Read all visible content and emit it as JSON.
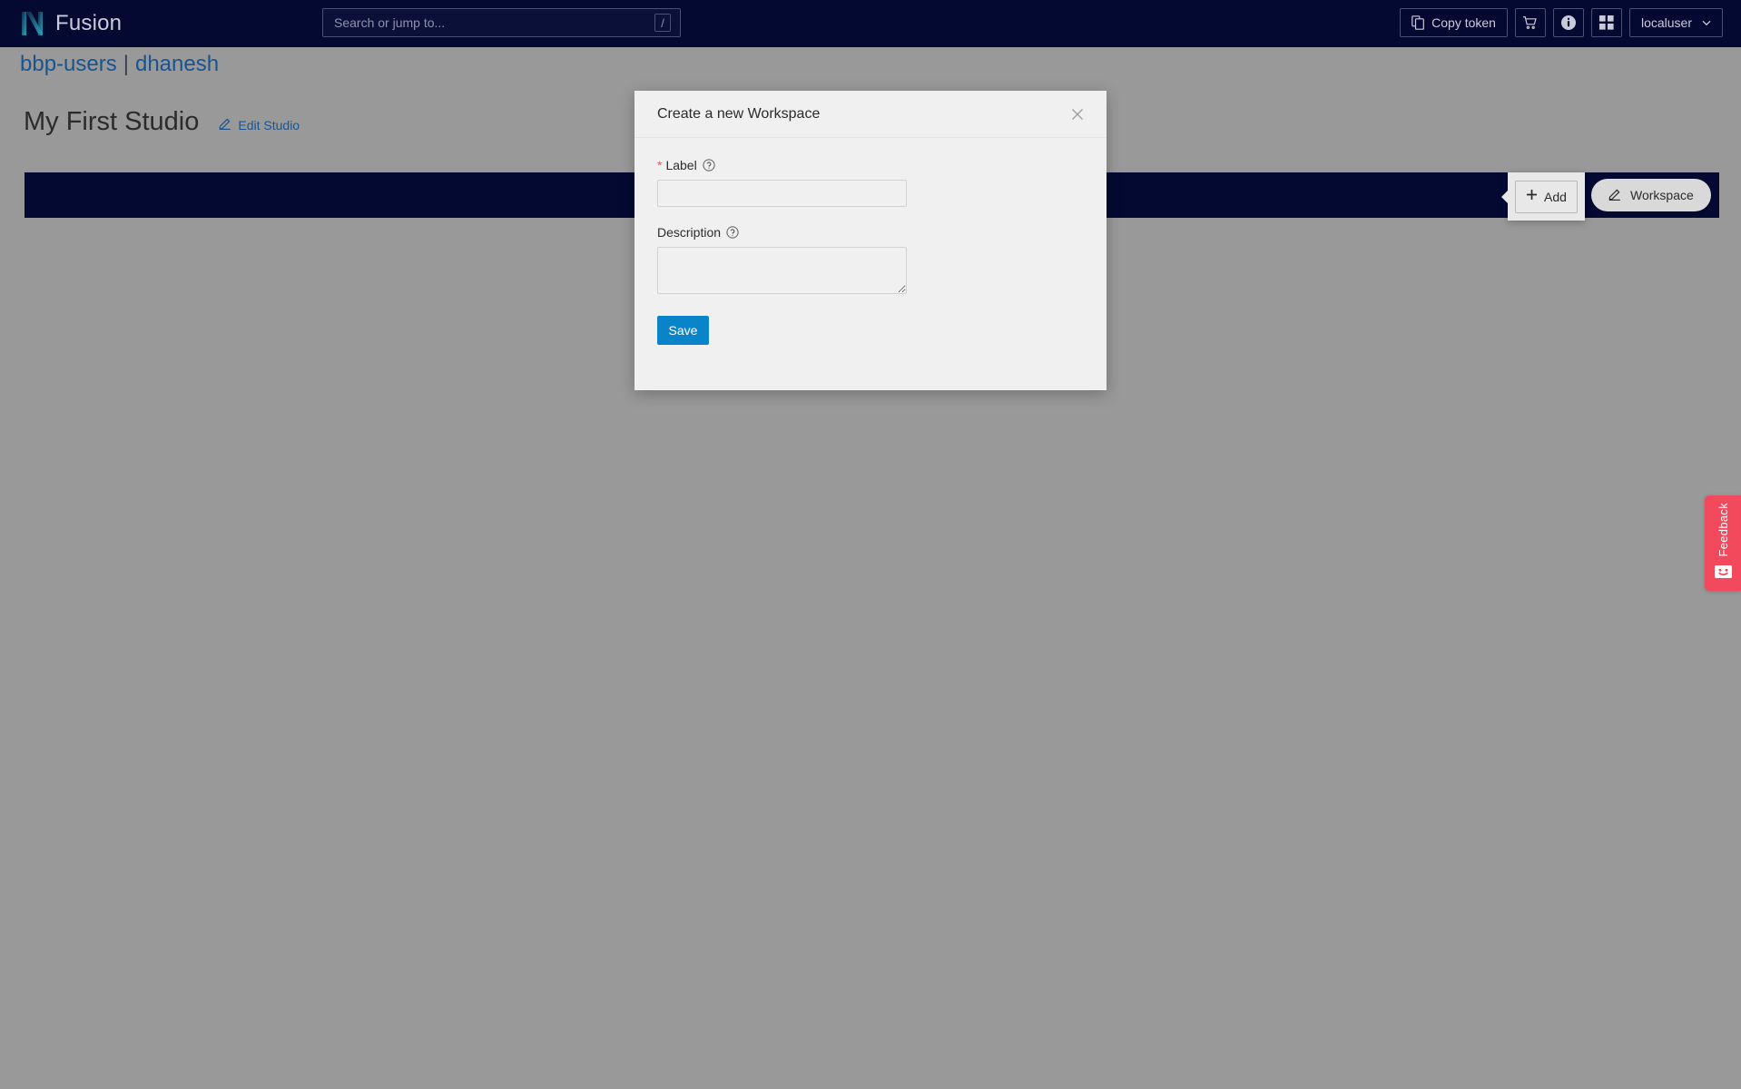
{
  "navbar": {
    "brand": "Fusion",
    "logo_icon": "nexus-n-logo",
    "search": {
      "placeholder": "Search or jump to...",
      "value": "",
      "shortcut_key": "/"
    },
    "copy_token_label": "Copy token",
    "cart_icon": "shopping-cart-icon",
    "info_icon": "info-circle-icon",
    "apps_icon": "grid-apps-icon",
    "user_label": "localuser",
    "user_caret": "⌄"
  },
  "breadcrumb": {
    "org": "bbp-users",
    "separator": "|",
    "project": "dhanesh"
  },
  "page": {
    "title": "My First Studio",
    "edit_link": "Edit Studio",
    "edit_icon": "pencil-edit-icon"
  },
  "content_bar": {
    "add_button_label": "Add",
    "add_icon": "plus-icon",
    "workspace_pill_label": "Workspace",
    "workspace_pill_icon": "pencil-edit-icon"
  },
  "modal": {
    "title": "Create a new Workspace",
    "close_icon": "close-x-icon",
    "label_field": {
      "label": "Label",
      "required_marker": "*",
      "help_icon": "question-circle-icon",
      "value": "",
      "placeholder": ""
    },
    "description_field": {
      "label": "Description",
      "help_icon": "question-circle-icon",
      "value": "",
      "placeholder": ""
    },
    "save_label": "Save"
  },
  "feedback": {
    "label": "Feedback",
    "icon": "smiley-face-icon"
  },
  "colors": {
    "navy": "#030931",
    "overlay_gray": "#999999",
    "link_blue": "#1a5490",
    "primary_blue": "#0a84c8",
    "feedback_red": "#f2495c",
    "required_red": "#ff4d4f"
  }
}
